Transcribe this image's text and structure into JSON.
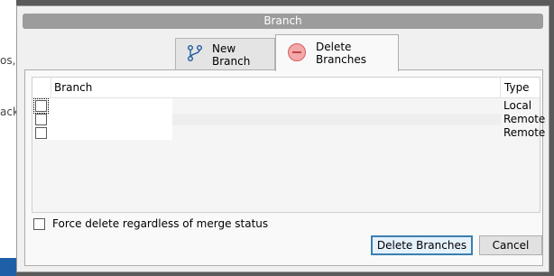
{
  "background": {
    "fragments": [
      "os,",
      "ack"
    ]
  },
  "dialog": {
    "title": "Branch",
    "tabs": [
      {
        "label": "New Branch",
        "icon": "branch-icon",
        "active": false
      },
      {
        "label": "Delete Branches",
        "icon": "minus-circle-icon",
        "active": true
      }
    ],
    "table": {
      "columns": [
        "Branch",
        "Type"
      ],
      "rows": [
        {
          "branch": "",
          "type": "Local",
          "checked": false
        },
        {
          "branch": "",
          "type": "Remote",
          "checked": false
        },
        {
          "branch": "",
          "type": "Remote",
          "checked": false
        }
      ]
    },
    "force_label": "Force delete regardless of merge status",
    "buttons": {
      "delete": "Delete Branches",
      "cancel": "Cancel"
    }
  },
  "colors": {
    "accent": "#3c7fb1",
    "delete_icon": "#e26b6b",
    "branch_icon": "#1e5aa0"
  }
}
